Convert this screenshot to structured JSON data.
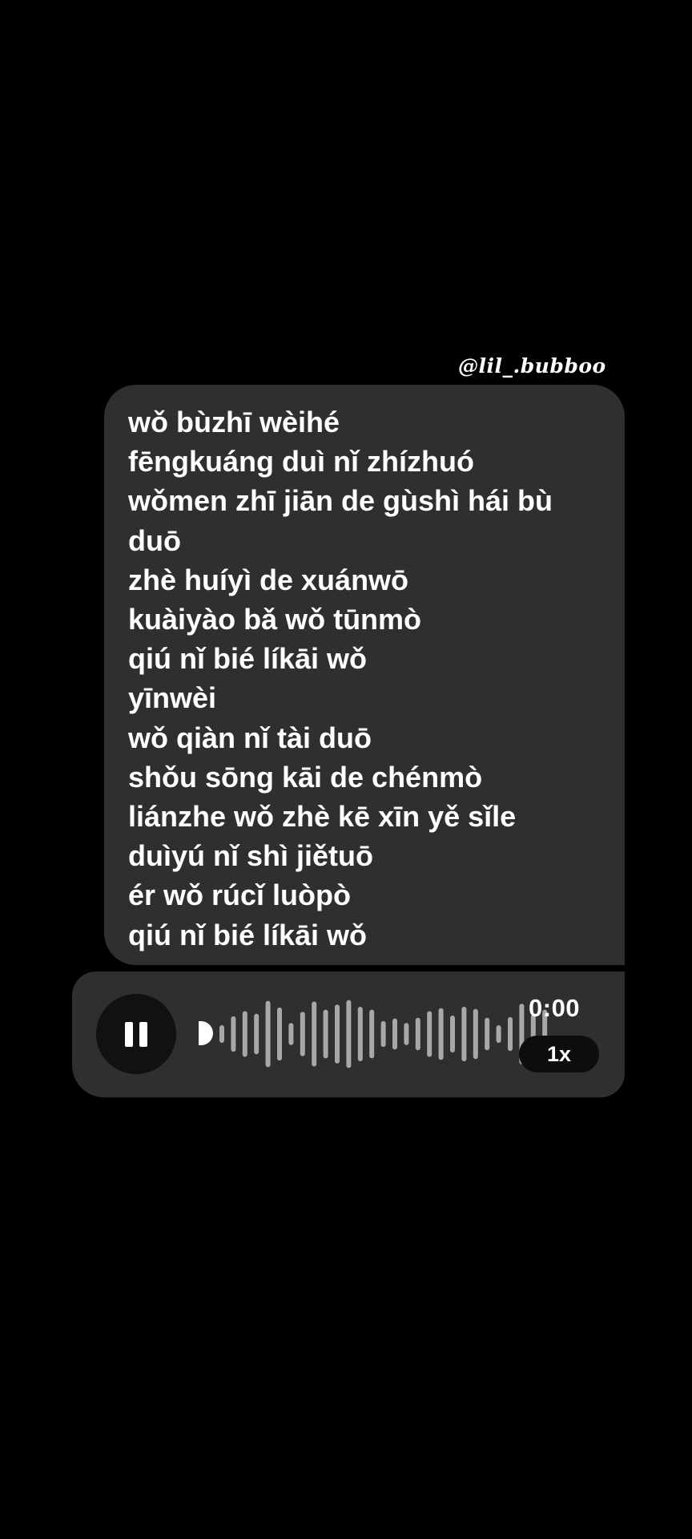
{
  "watermark": "@lil_.bubboo",
  "message": {
    "lines": [
      "wǒ bùzhī wèihé",
      "fēngkuáng duì nǐ zhízhuó",
      "wǒmen zhī jiān de gùshì hái bù",
      "duō",
      "zhè huíyì de xuánwō",
      "kuàiyào bǎ wǒ tūnmò",
      "qiú nǐ bié líkāi wǒ",
      "yīnwèi",
      "wǒ qiàn nǐ tài duō",
      "shǒu sōng kāi de chénmò",
      "liánzhe wǒ zhè kē xīn yě sǐle",
      "duìyú nǐ shì jiětuō",
      "ér wǒ rúcǐ luòpò",
      "qiú nǐ bié líkāi wǒ"
    ]
  },
  "voice_message": {
    "state_icon": "pause-icon",
    "elapsed": "0:00",
    "speed": "1x",
    "progress": 0,
    "waveform_levels": [
      0.24,
      0.48,
      0.62,
      0.55,
      0.9,
      0.72,
      0.3,
      0.6,
      0.88,
      0.66,
      0.8,
      0.92,
      0.74,
      0.66,
      0.35,
      0.42,
      0.3,
      0.44,
      0.62,
      0.7,
      0.5,
      0.74,
      0.68,
      0.44,
      0.24,
      0.46,
      0.82,
      0.52,
      0.66
    ],
    "colors": {
      "bar": "#a8a8a8",
      "bubble": "#2f2f2f",
      "button": "#111111"
    }
  }
}
